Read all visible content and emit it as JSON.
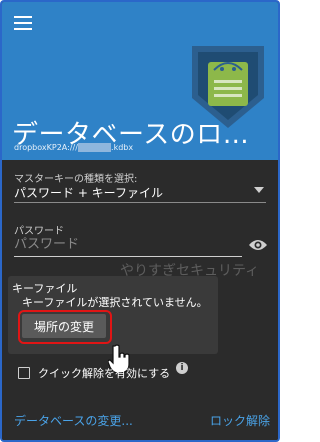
{
  "header": {
    "database_title": "データベースのロ…",
    "database_path_prefix": "dropboxKP2A:///",
    "database_path_masked": "xxxxxxx",
    "database_path_suffix": ".kdbx"
  },
  "master_key": {
    "label": "マスターキーの種類を選択:",
    "selected": "パスワード + キーファイル"
  },
  "password": {
    "label": "パスワード",
    "placeholder": "パスワード",
    "value": ""
  },
  "watermark": "やりすぎセキュリティ",
  "keyfile": {
    "title": "キーファイル",
    "message": "キーファイルが選択されていません。",
    "change_button": "場所の変更"
  },
  "quick_unlock": {
    "label": "クイック解除を有効にする",
    "checked": false
  },
  "footer": {
    "change_db": "データベースの変更...",
    "unlock": "ロック解除"
  },
  "colors": {
    "header_bg": "#2f82c7",
    "content_bg": "#2b2b2b",
    "accent": "#4aa3e8",
    "highlight": "#e01515",
    "logo_green": "#8db84a"
  },
  "icons": [
    "menu-icon",
    "keepass-android-logo-icon",
    "chevron-down-icon",
    "eye-icon",
    "info-icon",
    "hand-cursor-icon"
  ]
}
